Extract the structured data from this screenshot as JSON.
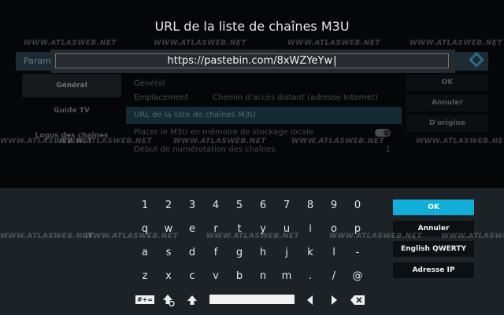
{
  "background": {
    "header_title": "Paramètres",
    "sidebar": [
      "Général",
      "Guide TV",
      "Logos des chaînes"
    ],
    "category": "Général",
    "rows": [
      {
        "label": "Emplacement",
        "value": "Chemin d'accès distant (adresse Internet)"
      },
      {
        "label": "URL de la liste de chaînes M3U",
        "value": ""
      },
      {
        "label": "Placer le M3U en mémoire de stockage locale",
        "value": ""
      },
      {
        "label": "Début de numérotation des chaînes",
        "value": "1"
      }
    ],
    "buttons": [
      "OK",
      "Annuler",
      "D'origine"
    ]
  },
  "dialog": {
    "title": "URL de la liste de chaînes M3U",
    "input_value": "https://pastebin.com/8xWZYeYw"
  },
  "keyboard": {
    "row1": [
      "1",
      "2",
      "3",
      "4",
      "5",
      "6",
      "7",
      "8",
      "9",
      "0"
    ],
    "row2": [
      "q",
      "w",
      "e",
      "r",
      "t",
      "y",
      "u",
      "i",
      "o",
      "p"
    ],
    "row3": [
      "a",
      "s",
      "d",
      "f",
      "g",
      "h",
      "j",
      "k",
      "l",
      "-"
    ],
    "row4": [
      "z",
      "x",
      "c",
      "v",
      "b",
      "n",
      "m",
      ".",
      "/",
      "@"
    ],
    "row5_icons": [
      "symbols-icon",
      "shift-icon",
      "uppercase-icon",
      "space-key",
      "cursor-left-icon",
      "cursor-right-icon",
      "backspace-icon"
    ],
    "symbols_label": "#+=",
    "side_buttons": [
      "OK",
      "Annuler",
      "English QWERTY",
      "Adresse IP"
    ]
  },
  "watermark": "WWW.ATLASWEB.NET",
  "colors": {
    "accent": "#12aed9",
    "keyboard_bg": "#1d2226",
    "input_frame": "#252a2e"
  }
}
